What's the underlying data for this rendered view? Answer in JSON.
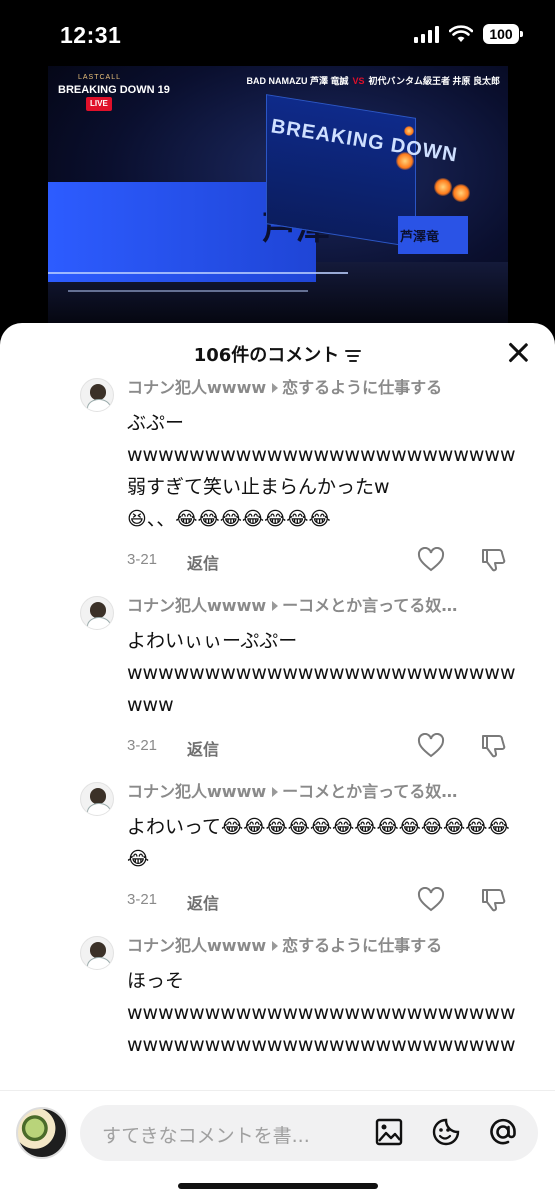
{
  "status_bar": {
    "time": "12:31",
    "battery": "100"
  },
  "video": {
    "logo_top": "LASTCALL",
    "logo_main": "BREAKING DOWN 19",
    "live_badge": "LIVE",
    "fighter_left": "BAD NAMAZU 芦澤 竜誠",
    "vs": "VS",
    "fighter_right": "初代バンタム級王者 井原 良太郎",
    "stage_text": "BREAKING DOWN",
    "screen_text": "芦澤",
    "screen_small_text": "芦澤竜"
  },
  "sheet": {
    "title": "106件のコメント",
    "comments": [
      {
        "user": "コナン犯人wwww",
        "reply_to": "恋するように仕事する",
        "text": "ぶぷー\nwwwwwwwwwwwwwwwwwwwwwwwww弱すぎて笑い止まらんかったw\n😆、、😂😂😂😂😂😂😂",
        "date": "3-21",
        "reply_label": "返信"
      },
      {
        "user": "コナン犯人wwww",
        "reply_to": "ーコメとか言ってる奴…",
        "text": "よわいぃぃーぷぷー\nwwwwwwwwwwwwwwwwwwwwwwwwwwww",
        "date": "3-21",
        "reply_label": "返信"
      },
      {
        "user": "コナン犯人wwww",
        "reply_to": "ーコメとか言ってる奴…",
        "text": "よわいって😂😂😂😂😂😂😂😂😂😂😂😂😂😂",
        "date": "3-21",
        "reply_label": "返信"
      },
      {
        "user": "コナン犯人wwww",
        "reply_to": "恋するように仕事する",
        "text": "ほっそ\nwwwwwwwwwwwwwwwwwwwwwwwwwwwwwwwwwwwwwwwwwwwwwwwwww",
        "date": "",
        "reply_label": ""
      }
    ]
  },
  "input": {
    "placeholder": "すてきなコメントを書..."
  },
  "colors": {
    "accent": "#111111",
    "muted": "#8a8a8a",
    "input_bg": "#f1f1f2"
  },
  "icons": [
    "filter-icon",
    "close-icon",
    "heart-icon",
    "thumbs-down-icon",
    "image-icon",
    "emoji-icon",
    "at-icon"
  ]
}
